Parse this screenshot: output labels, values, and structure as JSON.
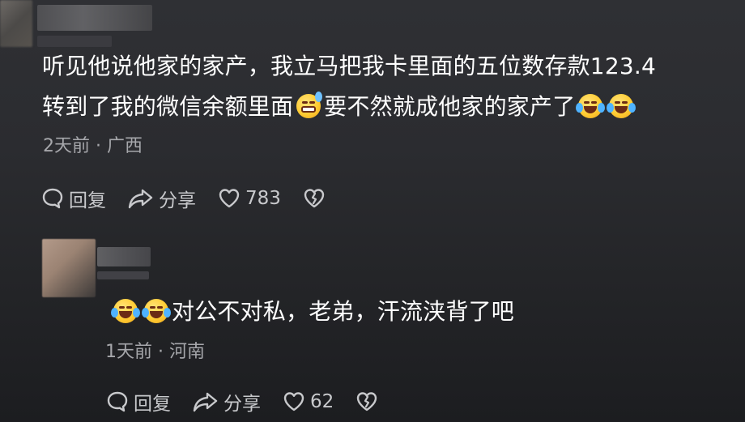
{
  "comments": [
    {
      "line1": "听见他说他家的家产，我立马把我卡里面的五位数存款123.4",
      "line2_prefix": "转到了我的微信余额里面",
      "line2_mid": "要不然就成他家的家产了",
      "time": "2天前",
      "location": "广西",
      "reply_label": "回复",
      "share_label": "分享",
      "likes": "783"
    },
    {
      "text": "对公不对私，老弟，汗流浃背了吧",
      "time": "1天前",
      "location": "河南",
      "reply_label": "回复",
      "share_label": "分享",
      "likes": "62"
    }
  ],
  "separator": "·",
  "colors": {
    "text": "#ffffff",
    "meta": "#a6a7ab",
    "action": "#c8c9cc",
    "background": "#2b2c30"
  }
}
